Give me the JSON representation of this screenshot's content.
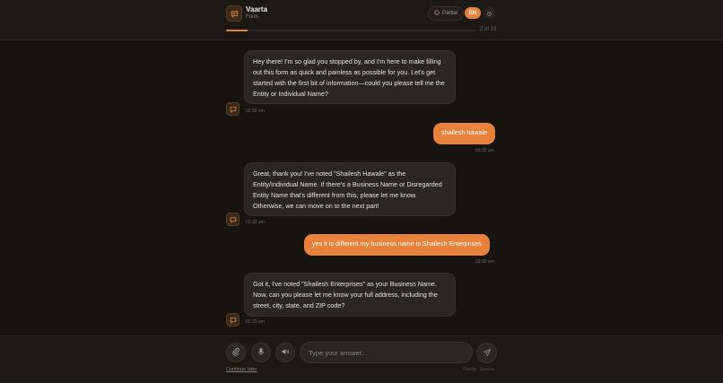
{
  "header": {
    "brand": "Vaarta",
    "subtitle": "Form",
    "partial_label": "Partial",
    "language": "EN",
    "progress_text": "2 of 23",
    "progress_fraction": 0.087
  },
  "messages": [
    {
      "role": "bot",
      "text": "Hey there! I'm so glad you stopped by, and I'm here to make filling out this form as quick and painless as possible for you. Let's get started with the first bit of information—could you please tell me the Entity or Individual Name?",
      "time": "02:32 am"
    },
    {
      "role": "user",
      "text": "shailesh hawale",
      "time": "02:32 am"
    },
    {
      "role": "bot",
      "text": "Great, thank you! I've noted \"Shailesh Hawale\" as the Entity/Individual Name. If there's a Business Name or Disregarded Entity Name that's different from this, please let me know. Otherwise, we can move on to the next part!",
      "time": "02:32 am"
    },
    {
      "role": "user",
      "text": "yes it is different my business name is Shailesh Enterprises",
      "time": "02:32 am"
    },
    {
      "role": "bot",
      "text": "Got it, I've noted \"Shailesh Enterprises\" as your Business Name. Now, can you please let me know your full address, including the street, city, state, and ZIP code?",
      "time": "02:32 am"
    }
  ],
  "composer": {
    "placeholder": "Type your answer...",
    "continue_label": "Continue later",
    "powered_by": "Vaarta · Secure"
  },
  "colors": {
    "accent": "#e8823a",
    "background": "#17130f",
    "bot_bubble": "#2a2621"
  },
  "icons": [
    "chat-icon",
    "partial-icon",
    "settings-icon",
    "paperclip-icon",
    "mic-icon",
    "speaker-icon",
    "send-icon"
  ]
}
